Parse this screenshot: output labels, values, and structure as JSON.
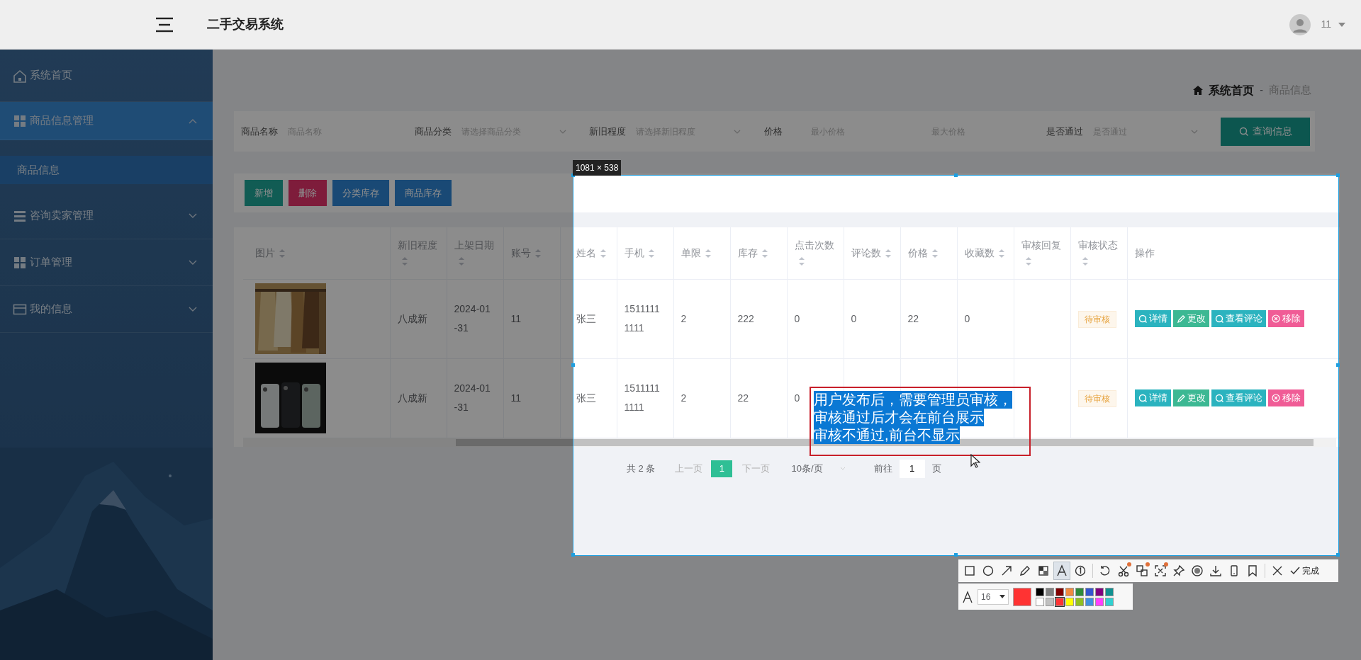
{
  "header": {
    "title": "二手交易系统",
    "user": "11"
  },
  "sidebar": {
    "items": [
      {
        "kind": "link",
        "label": "系统首页",
        "selected": false
      },
      {
        "kind": "group",
        "label": "商品信息管理",
        "selected": true,
        "expanded": true,
        "children": [
          {
            "label": "商品信息",
            "selected": true
          }
        ]
      },
      {
        "kind": "group",
        "label": "咨询卖家管理",
        "selected": false,
        "expanded": false
      },
      {
        "kind": "group",
        "label": "订单管理",
        "selected": false,
        "expanded": false
      },
      {
        "kind": "group",
        "label": "我的信息",
        "selected": false,
        "expanded": false
      }
    ]
  },
  "breadcrumb": {
    "items": [
      {
        "label": "系统首页",
        "selected": false
      },
      {
        "label": "商品信息",
        "selected": true
      }
    ],
    "separator": "-"
  },
  "search": {
    "fields": [
      {
        "kind": "input",
        "label": "商品名称",
        "placeholder": "商品名称"
      },
      {
        "kind": "select",
        "label": "商品分类",
        "placeholder": "请选择商品分类"
      },
      {
        "kind": "select",
        "label": "新旧程度",
        "placeholder": "请选择新旧程度"
      },
      {
        "kind": "range",
        "label": "价格",
        "min": {
          "placeholder": "最小价格"
        },
        "max": {
          "placeholder": "最大价格"
        }
      },
      {
        "kind": "select",
        "label": "是否通过",
        "placeholder": "是否通过"
      }
    ],
    "button": "查询信息"
  },
  "actions": [
    {
      "label": "新增",
      "kind": "success"
    },
    {
      "label": "删除",
      "kind": "danger"
    },
    {
      "label": "分类库存",
      "kind": "primary"
    },
    {
      "label": "商品库存",
      "kind": "primary"
    }
  ],
  "table": {
    "columns": [
      {
        "label": "图片",
        "sortable": true
      },
      {
        "label": "新旧程度",
        "sortable": true
      },
      {
        "label": "上架日期",
        "sortable": true
      },
      {
        "label": "账号",
        "sortable": true
      },
      {
        "label": "姓名",
        "sortable": true
      },
      {
        "label": "手机",
        "sortable": true
      },
      {
        "label": "单限",
        "sortable": true
      },
      {
        "label": "库存",
        "sortable": true
      },
      {
        "label": "点击次数",
        "sortable": true
      },
      {
        "label": "评论数",
        "sortable": true
      },
      {
        "label": "价格",
        "sortable": true
      },
      {
        "label": "收藏数",
        "sortable": true
      },
      {
        "label": "审核回复",
        "sortable": true
      },
      {
        "label": "审核状态",
        "sortable": true
      },
      {
        "label": "操作",
        "sortable": false
      }
    ],
    "rows": [
      {
        "image": {
          "kind": "picture"
        },
        "condition": "八成新",
        "date": "2024-01-31",
        "account": "11",
        "name": "张三",
        "phone": "15111111111",
        "limit": "2",
        "stock": "222",
        "clicks": "0",
        "comments": "0",
        "price": "22",
        "favorites": "0",
        "status": "待审核",
        "operations": [
          {
            "label": "详情",
            "kind": "detail"
          },
          {
            "label": "更改",
            "kind": "edit"
          },
          {
            "label": "查看评论",
            "kind": "detail"
          },
          {
            "label": "移除",
            "kind": "delete"
          }
        ]
      },
      {
        "image": {
          "kind": "picture"
        },
        "condition": "八成新",
        "date": "2024-01-31",
        "account": "11",
        "name": "张三",
        "phone": "15111111111",
        "limit": "2",
        "stock": "22",
        "clicks": "0",
        "status": "待审核",
        "operations": [
          {
            "label": "详情",
            "kind": "detail"
          },
          {
            "label": "更改",
            "kind": "edit"
          },
          {
            "label": "查看评论",
            "kind": "detail"
          },
          {
            "label": "移除",
            "kind": "delete"
          }
        ]
      }
    ]
  },
  "pagination": {
    "total": "共 2 条",
    "prev": "上一页",
    "pages": [
      {
        "label": "1",
        "selected": true
      }
    ],
    "next": "下一页",
    "page_size": "10条/页",
    "goto": "前往",
    "goto_value": "1",
    "page_unit": "页"
  },
  "capture": {
    "selection_size": "1081 × 538",
    "annotation_lines": [
      "用户发布后，需要管理员审核，",
      "审核通过后才会在前台展示",
      "审核不通过,前台不显示"
    ],
    "tools": [
      {
        "kind": "rectangle",
        "selected": false,
        "dot": false
      },
      {
        "kind": "ellipse",
        "selected": false,
        "dot": false
      },
      {
        "kind": "arrow",
        "selected": false,
        "dot": false
      },
      {
        "kind": "pencil",
        "selected": false,
        "dot": false
      },
      {
        "kind": "mosaic",
        "selected": false,
        "dot": false
      },
      {
        "kind": "text",
        "selected": true,
        "dot": false
      },
      {
        "kind": "number",
        "selected": false,
        "dot": false
      },
      {
        "kind": "undo",
        "selected": false,
        "dot": false
      },
      {
        "kind": "scissors",
        "selected": false,
        "dot": true
      },
      {
        "kind": "translate",
        "selected": false,
        "dot": true
      },
      {
        "kind": "ocr",
        "selected": false,
        "dot": true
      },
      {
        "kind": "pin",
        "selected": false,
        "dot": false
      },
      {
        "kind": "record",
        "selected": false,
        "dot": false
      },
      {
        "kind": "download",
        "selected": false,
        "dot": false
      },
      {
        "kind": "phone",
        "selected": false,
        "dot": false
      },
      {
        "kind": "bookmark",
        "selected": false,
        "dot": false
      },
      {
        "kind": "close",
        "selected": false,
        "dot": false
      }
    ],
    "done": "完成",
    "size_value": "16",
    "palette": [
      {
        "color": "#000000",
        "selected": false
      },
      {
        "color": "#808080",
        "selected": false
      },
      {
        "color": "#800000",
        "selected": false
      },
      {
        "color": "#f08a40",
        "selected": false
      },
      {
        "color": "#2e8b3a",
        "selected": false
      },
      {
        "color": "#3355d0",
        "selected": false
      },
      {
        "color": "#800080",
        "selected": false
      },
      {
        "color": "#109090",
        "selected": false
      },
      {
        "color": "#ffffff",
        "selected": false
      },
      {
        "color": "#c0c0c0",
        "selected": false
      },
      {
        "color": "#ff3333",
        "selected": true
      },
      {
        "color": "#ffff00",
        "selected": false
      },
      {
        "color": "#90c020",
        "selected": false
      },
      {
        "color": "#4090e0",
        "selected": false
      },
      {
        "color": "#ff40ff",
        "selected": false
      },
      {
        "color": "#30d0d0",
        "selected": false
      }
    ]
  }
}
